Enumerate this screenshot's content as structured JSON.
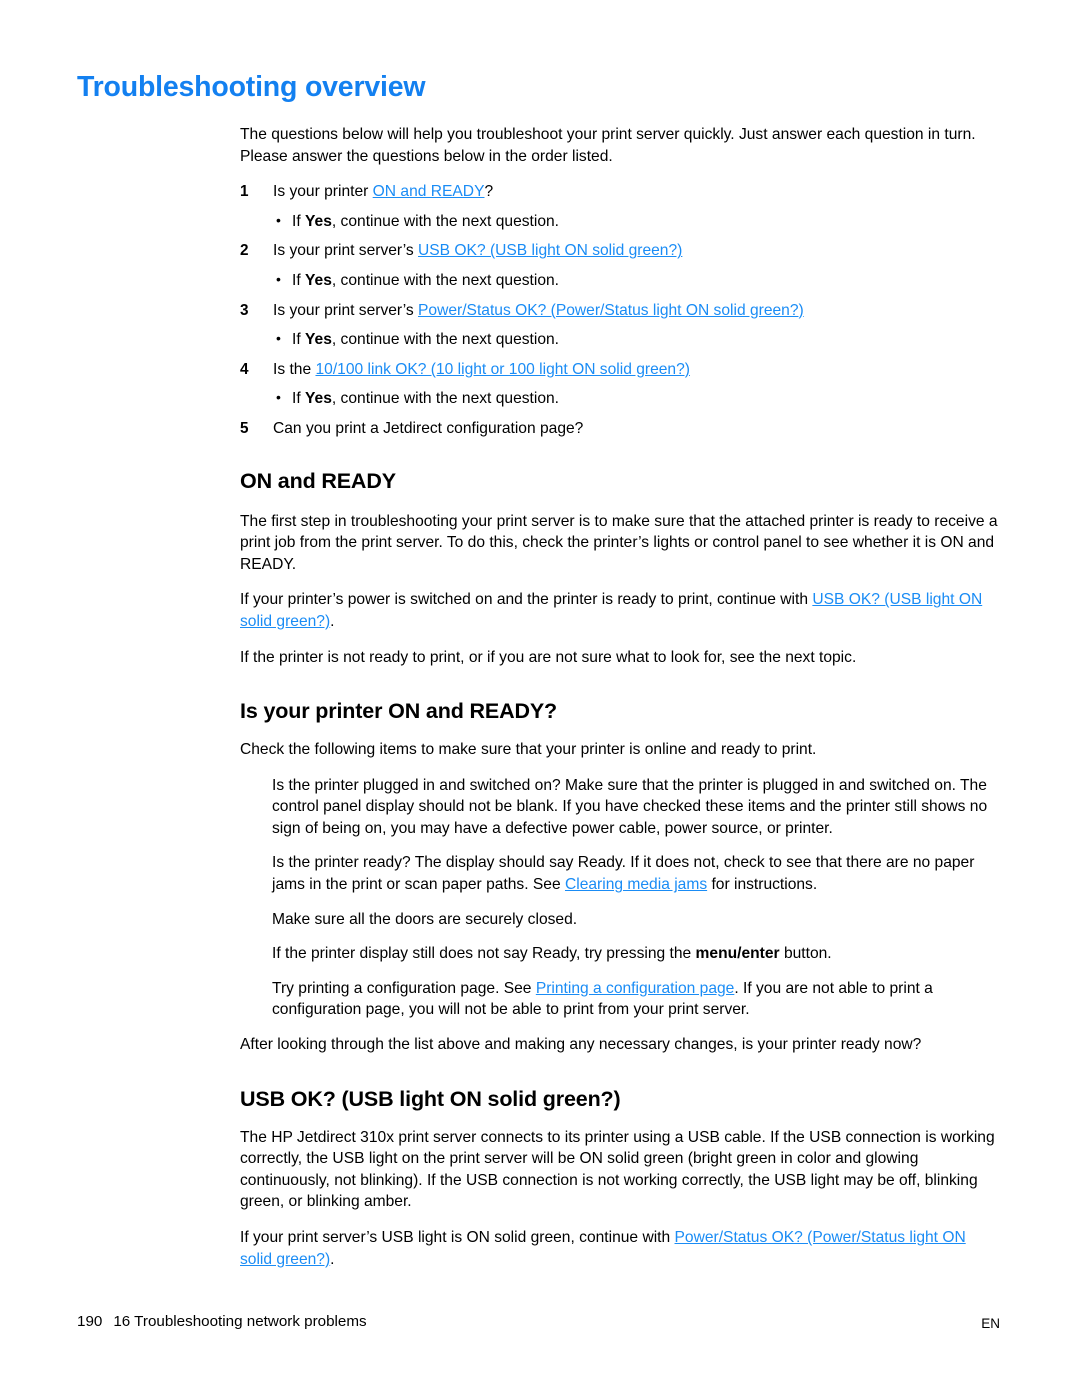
{
  "page": {
    "title": "Troubleshooting overview",
    "title_color": "#1380f0",
    "link_color": "#1a8cf5"
  },
  "intro": {
    "text": "The questions below will help you troubleshoot your print server quickly. Just answer each question in turn. Please answer the questions below in the order listed."
  },
  "checklist": {
    "items": [
      {
        "number": "1",
        "lead": "Is your printer ",
        "link": "ON and READY",
        "tail": "?",
        "sub_prefix": "If ",
        "sub_bold": "Yes",
        "sub_suffix": ", continue with the next question."
      },
      {
        "number": "2",
        "lead": "Is your print server’s ",
        "link": "USB OK? (USB light ON solid green?)",
        "tail": "",
        "sub_prefix": "If ",
        "sub_bold": "Yes",
        "sub_suffix": ", continue with the next question."
      },
      {
        "number": "3",
        "lead": "Is your print server’s ",
        "link": "Power/Status OK? (Power/Status light ON solid green?)",
        "tail": "",
        "sub_prefix": "If ",
        "sub_bold": "Yes",
        "sub_suffix": ", continue with the next question."
      },
      {
        "number": "4",
        "lead": "Is the ",
        "link": "10/100 link OK? (10 light or 100 light ON solid green?)",
        "tail": "",
        "sub_prefix": "If ",
        "sub_bold": "Yes",
        "sub_suffix": ", continue with the next question."
      },
      {
        "number": "5",
        "lead": "Can you print a Jetdirect configuration page?",
        "link": "",
        "tail": "",
        "sub_prefix": "",
        "sub_bold": "",
        "sub_suffix": ""
      }
    ]
  },
  "section_on_and_ready": {
    "heading": "ON and READY",
    "para1": "The first step in troubleshooting your print server is to make sure that the attached printer is ready to receive a print job from the print server. To do this, check the printer’s lights or control panel to see whether it is ON and READY.",
    "para2_lead": "If your printer’s power is switched on and the printer is ready to print, continue with ",
    "para2_link": "USB OK? (USB light ON solid green?)",
    "para2_tail": ".",
    "para3": "If the printer is not ready to print, or if you are not sure what to look for, see the next topic."
  },
  "section_printer_ready": {
    "heading": "Is your printer ON and READY?",
    "intro": "Check the following items to make sure that your printer is online and ready to print.",
    "item1": "Is the printer plugged in and switched on? Make sure that the printer is plugged in and switched on. The control panel display should not be blank. If you have checked these items and the printer still shows no sign of being on, you may have a defective power cable, power source, or printer.",
    "item2_lead": "Is the printer ready? The display should say Ready. If it does not, check to see that there are no paper jams in the print or scan paper paths. See ",
    "item2_link": "Clearing media jams",
    "item2_tail": " for instructions.",
    "item3": "Make sure all the doors are securely closed.",
    "item4_lead": "If the printer display still does not say Ready, try pressing the ",
    "item4_bold": "menu/enter",
    "item4_tail": " button.",
    "item5_lead": "Try printing a configuration page. See ",
    "item5_link": "Printing a configuration page",
    "item5_tail": ". If you are not able to print a configuration page, you will not be able to print from your print server.",
    "closing": "After looking through the list above and making any necessary changes, is your printer ready now?"
  },
  "section_usb_ok": {
    "heading": "USB OK? (USB light ON solid green?)",
    "para1": "The HP Jetdirect 310x print server connects to its printer using a USB cable. If the USB connection is working correctly, the USB light on the print server will be ON solid green (bright green in color and glowing continuously, not blinking). If the USB connection is not working correctly, the USB light may be off, blinking green, or blinking amber.",
    "para2_lead": "If your print server’s USB light is ON solid green, continue with ",
    "para2_link": "Power/Status OK? (Power/Status light ON solid green?)",
    "para2_tail": "."
  },
  "footer": {
    "page_number": "190",
    "chapter": "16 Troubleshooting network problems",
    "language": "EN"
  }
}
